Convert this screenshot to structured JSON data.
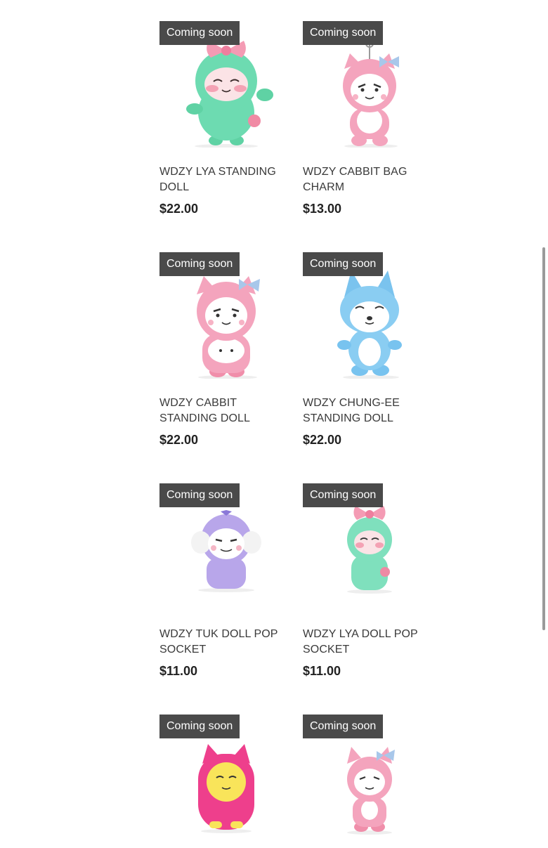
{
  "products": [
    {
      "badge": "Coming soon",
      "title": "WDZY LYA STANDING DOLL",
      "price": "$22.00",
      "icon": "lya-green-plush-icon"
    },
    {
      "badge": "Coming soon",
      "title": "WDZY CABBIT BAG CHARM",
      "price": "$13.00",
      "icon": "cabbit-pink-bag-charm-icon"
    },
    {
      "badge": "Coming soon",
      "title": "WDZY CABBIT STANDING DOLL",
      "price": "$22.00",
      "icon": "cabbit-pink-standing-plush-icon"
    },
    {
      "badge": "Coming soon",
      "title": "WDZY CHUNG-EE STANDING DOLL",
      "price": "$22.00",
      "icon": "chung-ee-blue-fox-plush-icon"
    },
    {
      "badge": "Coming soon",
      "title": "WDZY TUK DOLL POP SOCKET",
      "price": "$11.00",
      "icon": "tuk-purple-plush-icon"
    },
    {
      "badge": "Coming soon",
      "title": "WDZY LYA DOLL POP SOCKET",
      "price": "$11.00",
      "icon": "lya-green-small-plush-icon"
    },
    {
      "badge": "Coming soon",
      "title": "",
      "price": "",
      "icon": "yellow-cat-pink-costume-plush-icon"
    },
    {
      "badge": "Coming soon",
      "title": "",
      "price": "",
      "icon": "cabbit-pink-small-plush-icon"
    }
  ]
}
